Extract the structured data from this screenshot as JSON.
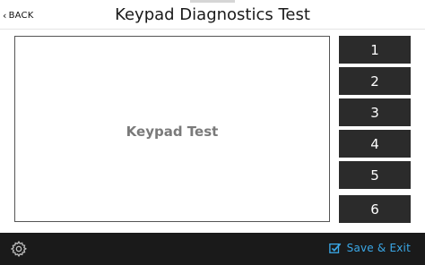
{
  "header": {
    "back_label": "BACK",
    "title": "Keypad Diagnostics Test"
  },
  "test_panel": {
    "label": "Keypad Test"
  },
  "keys": [
    "1",
    "2",
    "3",
    "4",
    "5",
    "6"
  ],
  "footer": {
    "save_label": "Save & Exit",
    "icons": [
      "gear-icon",
      "checkbox-check-icon"
    ]
  },
  "colors": {
    "key_bg": "#2b2b2b",
    "footer_bg": "#1a1a1a",
    "accent": "#3aa7e6"
  }
}
